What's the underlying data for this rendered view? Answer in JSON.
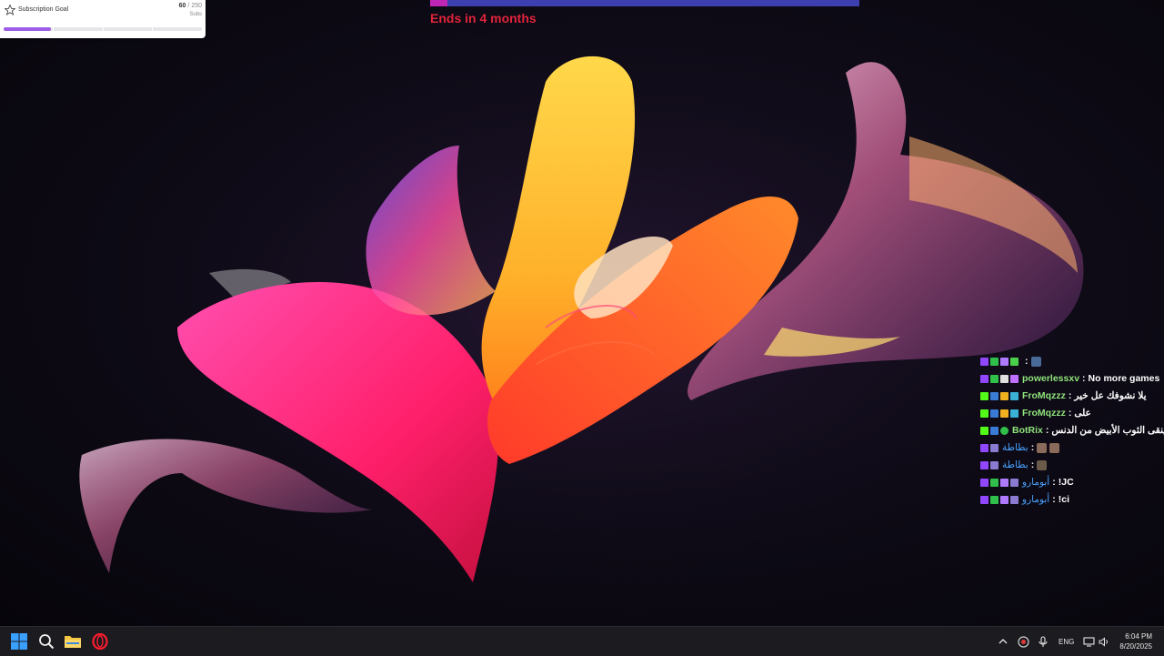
{
  "subscription_goal": {
    "title": "Subscription Goal",
    "current": "60",
    "separator": "/",
    "target": "250",
    "unit": "Subs",
    "progress_fraction": 0.24
  },
  "banner": {
    "text": "Ends in 4 months",
    "progress_fraction": 0.04,
    "color": "#e0243a"
  },
  "chat": {
    "messages": [
      {
        "user": "",
        "message": ""
      },
      {
        "user": "powerlessxv",
        "message": "No more games"
      },
      {
        "user": "FroMqzzz",
        "message": "يلا نشوفك عل خير"
      },
      {
        "user": "FroMqzzz",
        "message": "على"
      },
      {
        "user": "BotRix",
        "message": "كما ينقى الثوب الأبيض من الدنس"
      },
      {
        "user": "بطاطة",
        "message": ""
      },
      {
        "user": "بطاطة",
        "message": ""
      },
      {
        "user": "أبومارو",
        "message": "!JC"
      },
      {
        "user": "أبومارو",
        "message": "!ci"
      }
    ],
    "separator": ":"
  },
  "taskbar": {
    "language": "ENG",
    "time": "6:04 PM",
    "date": "8/20/2025",
    "icons": [
      "windows-start-icon",
      "search-icon",
      "file-explorer-icon",
      "opera-icon"
    ],
    "tray_icons": [
      "chevron-up-icon",
      "shield-icon",
      "microphone-icon",
      "network-icon",
      "volume-icon"
    ]
  },
  "colors": {
    "accent_purple": "#9b5de5",
    "chat_user_green": "#8fe37a",
    "chat_user_blue": "#4aa3ff",
    "taskbar_bg": "#1c1c20"
  }
}
